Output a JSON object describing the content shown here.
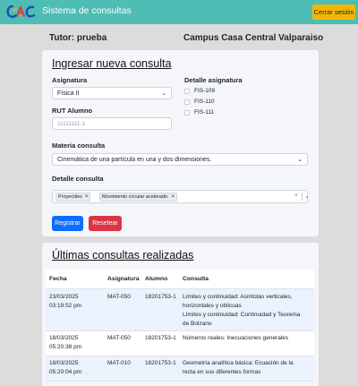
{
  "header": {
    "app_title": "Sistema de consultas",
    "logout_label": "Cerrar sesión",
    "logo_letters": "CIAC"
  },
  "info": {
    "tutor": "Tutor: prueba",
    "campus": "Campus Casa Central Valparaiso"
  },
  "form": {
    "title": "Ingresar nueva consulta",
    "asignatura_label": "Asignatura",
    "asignatura_value": "Física II",
    "detalle_asignatura_label": "Detalle asignatura",
    "detalle_options": [
      "FIS-109",
      "FIS-110",
      "FIS-111"
    ],
    "rut_label": "RUT Alumno",
    "rut_placeholder": "11111111-1",
    "materia_label": "Materia consulta",
    "materia_value": "Cinemática de una partícula en una y dos dimensiones.",
    "detalle_consulta_label": "Detalle consulta",
    "detalle_tags": [
      "Proyectiles",
      "Movimiento circular acelerado."
    ],
    "register_label": "Registrar",
    "reset_label": "Resetear"
  },
  "history": {
    "title": "Últimas consultas realizadas",
    "columns": [
      "Fecha",
      "Asignatura",
      "Alumno",
      "Consulta"
    ],
    "rows": [
      {
        "fecha_1": "23/03/2025",
        "fecha_2": "03:19:52 pm",
        "asignatura": "MAT-050",
        "alumno": "18201753-1",
        "consulta_lines": [
          "Límites y continuidad: Asíntotas verticales,",
          "horizontales y oblicuas",
          "Límites y continuidad: Continuidad y Teorema",
          "de Bolzano"
        ]
      },
      {
        "fecha_1": "18/03/2025",
        "fecha_2": "05:20:38 pm",
        "asignatura": "MAT-050",
        "alumno": "18201753-1",
        "consulta_lines": [
          "Números reales: Inecuaciones generales"
        ]
      },
      {
        "fecha_1": "18/03/2025",
        "fecha_2": "05:20:04 pm",
        "asignatura": "MAT-010",
        "alumno": "18201753-1",
        "consulta_lines": [
          "Geometría analítica básica: Ecuación de la",
          "recta en sus diferentes formas"
        ]
      }
    ]
  },
  "colors": {
    "topbar": "#4ebdb4",
    "logout": "#f2b705",
    "primary": "#0d6efd",
    "danger": "#dc3545"
  }
}
